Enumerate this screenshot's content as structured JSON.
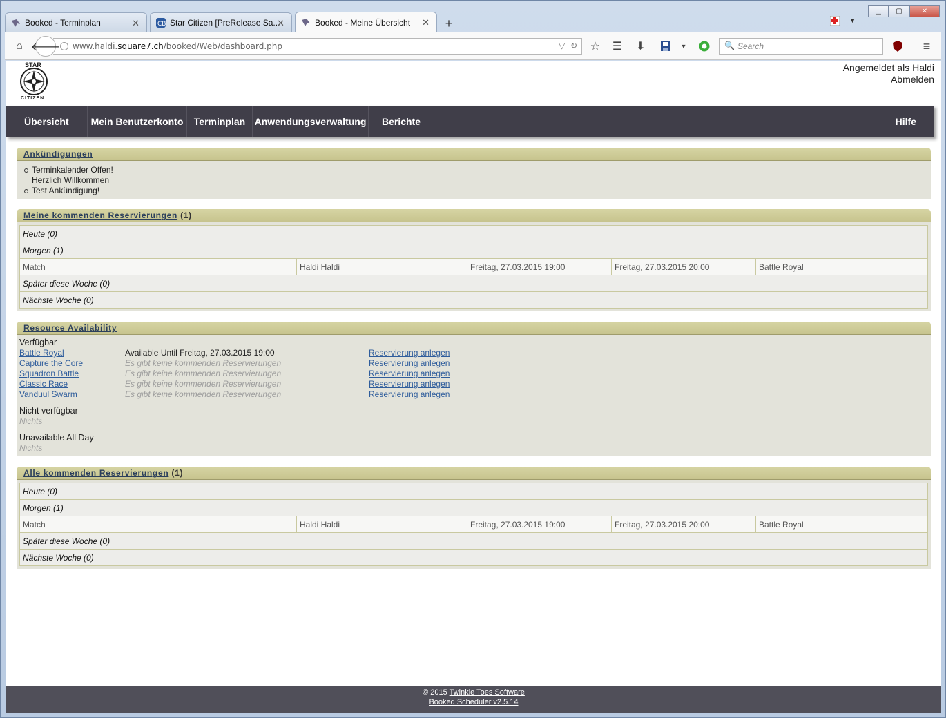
{
  "browser": {
    "tabs": [
      {
        "title": "Booked - Terminplan",
        "active": false
      },
      {
        "title": "Star Citizen [PreRelease Sa...",
        "active": false
      },
      {
        "title": "Booked - Meine Übersicht",
        "active": true
      }
    ],
    "url_prefix": "www.haldi.",
    "url_host": "square7.ch",
    "url_path": "/booked/Web/dashboard.php",
    "search_placeholder": "Search"
  },
  "header": {
    "logo_top": "STAR",
    "logo_bottom": "CITIZEN",
    "logged_in_text": "Angemeldet als Haldi",
    "logout_label": "Abmelden"
  },
  "nav": {
    "items": [
      "Übersicht",
      "Mein Benutzerkonto",
      "Terminplan",
      "Anwendungsverwaltung",
      "Berichte"
    ],
    "help": "Hilfe"
  },
  "announcements": {
    "title": "Ankündigungen",
    "items": [
      {
        "line1": "Terminkalender Offen!",
        "line2": "Herzlich Willkommen"
      },
      {
        "line1": "Test Ankündigung!",
        "line2": ""
      }
    ]
  },
  "my_reservations": {
    "title": "Meine kommenden Reservierungen",
    "count": "(1)",
    "groups": {
      "today": "Heute (0)",
      "tomorrow": "Morgen (1)",
      "later_week": "Später diese Woche (0)",
      "next_week": "Nächste Woche (0)"
    },
    "row": {
      "title": "Match",
      "user": "Haldi Haldi",
      "start": "Freitag, 27.03.2015 19:00",
      "end": "Freitag, 27.03.2015 20:00",
      "resource": "Battle Royal"
    }
  },
  "availability": {
    "title": "Resource Availability",
    "available_label": "Verfügbar",
    "resources": [
      {
        "name": "Battle Royal",
        "status": "Available Until Freitag, 27.03.2015 19:00",
        "muted": false,
        "action": "Reservierung anlegen"
      },
      {
        "name": "Capture the Core",
        "status": "Es gibt keine kommenden Reservierungen",
        "muted": true,
        "action": "Reservierung anlegen"
      },
      {
        "name": "Squadron Battle",
        "status": "Es gibt keine kommenden Reservierungen",
        "muted": true,
        "action": "Reservierung anlegen"
      },
      {
        "name": "Classic Race",
        "status": "Es gibt keine kommenden Reservierungen",
        "muted": true,
        "action": "Reservierung anlegen"
      },
      {
        "name": "Vanduul Swarm",
        "status": "Es gibt keine kommenden Reservierungen",
        "muted": true,
        "action": "Reservierung anlegen"
      }
    ],
    "unavailable_label": "Nicht verfügbar",
    "unavailable_value": "Nichts",
    "unavailable_all_day_label": "Unavailable All Day",
    "unavailable_all_day_value": "Nichts"
  },
  "all_reservations": {
    "title": "Alle kommenden Reservierungen",
    "count": "(1)",
    "groups": {
      "today": "Heute (0)",
      "tomorrow": "Morgen (1)",
      "later_week": "Später diese Woche (0)",
      "next_week": "Nächste Woche (0)"
    },
    "row": {
      "title": "Match",
      "user": "Haldi Haldi",
      "start": "Freitag, 27.03.2015 19:00",
      "end": "Freitag, 27.03.2015 20:00",
      "resource": "Battle Royal"
    }
  },
  "footer": {
    "copyright": "© 2015",
    "company": "Twinkle Toes Software",
    "product": "Booked Scheduler v2.5.14"
  }
}
